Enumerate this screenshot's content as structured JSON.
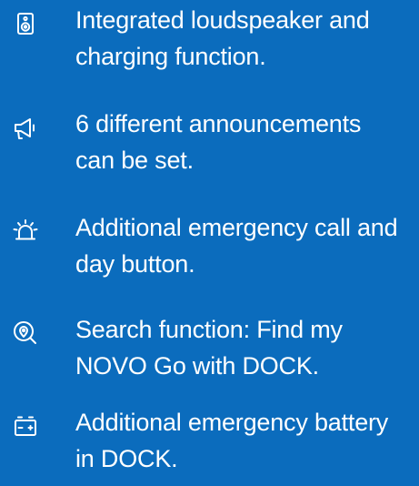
{
  "features": [
    {
      "icon": "speaker-icon",
      "line1": "Integrated loudspeaker and",
      "line2": "charging function."
    },
    {
      "icon": "megaphone-icon",
      "line1": "6 different announcements",
      "line2": "can be set."
    },
    {
      "icon": "alarm-light-icon",
      "line1": "Additional emergency call and",
      "line2": "day button."
    },
    {
      "icon": "location-search-icon",
      "line1": "Search function: Find my",
      "line2": "NOVO Go with DOCK."
    },
    {
      "icon": "battery-icon",
      "line1": "Additional emergency battery",
      "line2": "in DOCK."
    }
  ],
  "colors": {
    "background": "#0b6cbd",
    "text": "#ffffff"
  }
}
